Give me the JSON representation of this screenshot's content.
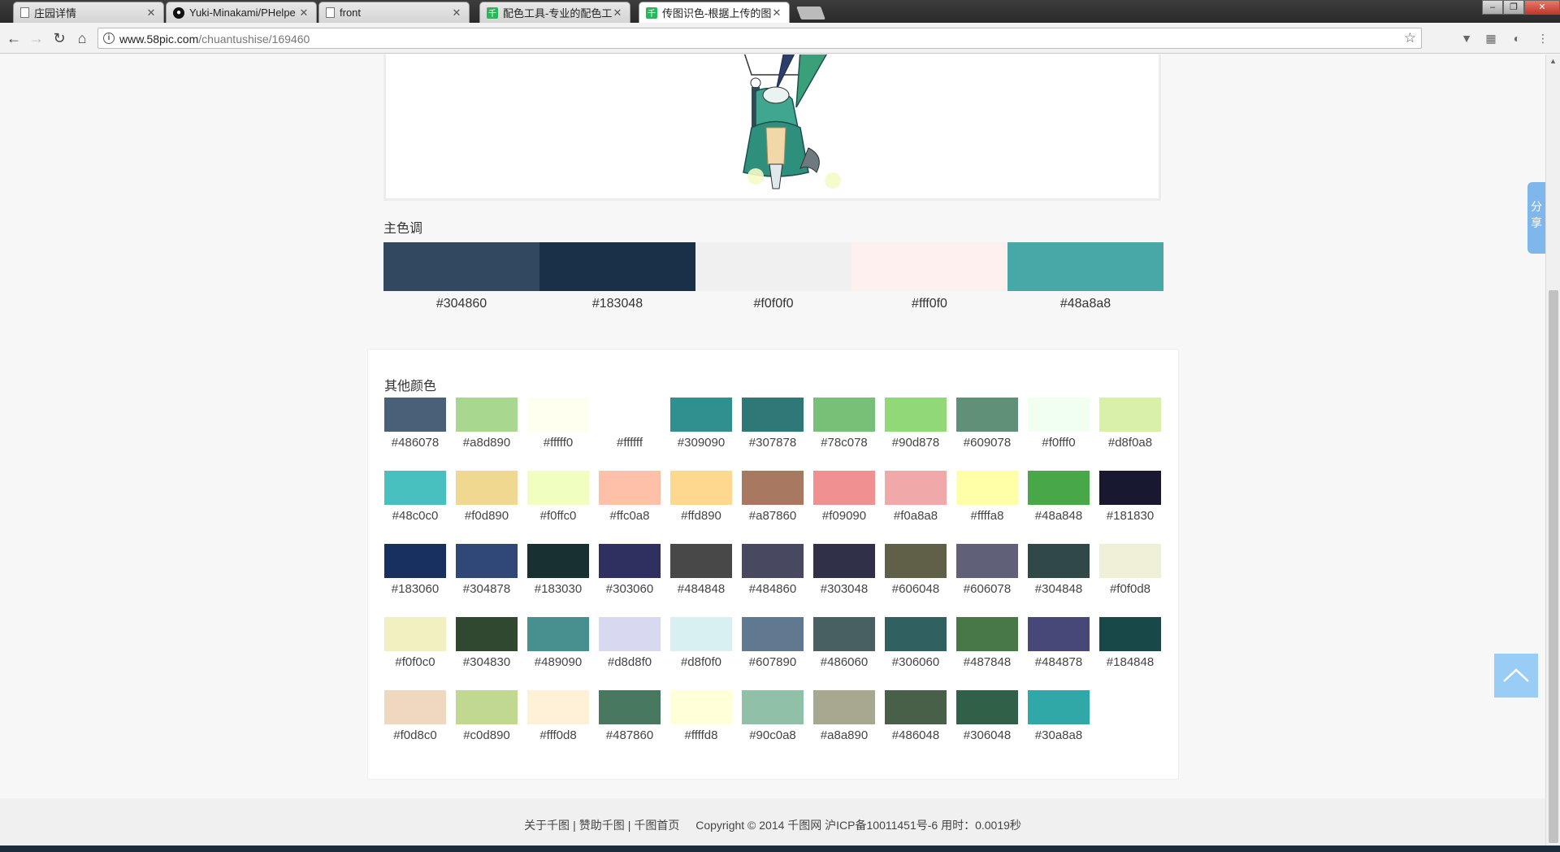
{
  "browser": {
    "tabs": [
      {
        "title": "庄园详情",
        "icon": "doc-icon",
        "active": false
      },
      {
        "title": "Yuki-Minakami/PHelpe",
        "icon": "github-icon",
        "active": false
      },
      {
        "title": "front",
        "icon": "doc-icon",
        "active": false
      },
      {
        "title": "配色工具-专业的配色工具",
        "icon": "qian-icon",
        "active": false
      },
      {
        "title": "传图识色-根据上传的图片",
        "icon": "qian-icon",
        "active": true
      }
    ],
    "window_controls": {
      "minimize": "‒",
      "restore": "❐",
      "close": "✕"
    },
    "url_host": "www.58pic.com",
    "url_path": "/chuantushise/169460"
  },
  "main_colors": {
    "title": "主色调",
    "items": [
      {
        "hex": "#304860",
        "label": "#304860"
      },
      {
        "hex": "#183048",
        "label": "#183048"
      },
      {
        "hex": "#f0f0f0",
        "label": "#f0f0f0"
      },
      {
        "hex": "#fff0f0",
        "label": "#fff0f0"
      },
      {
        "hex": "#48a8a8",
        "label": "#48a8a8"
      }
    ]
  },
  "other_colors": {
    "title": "其他颜色",
    "items": [
      "#486078",
      "#a8d890",
      "#fffff0",
      "#ffffff",
      "#309090",
      "#307878",
      "#78c078",
      "#90d878",
      "#609078",
      "#f0fff0",
      "#d8f0a8",
      "#48c0c0",
      "#f0d890",
      "#f0ffc0",
      "#ffc0a8",
      "#ffd890",
      "#a87860",
      "#f09090",
      "#f0a8a8",
      "#ffffa8",
      "#48a848",
      "#181830",
      "#183060",
      "#304878",
      "#183030",
      "#303060",
      "#484848",
      "#484860",
      "#303048",
      "#606048",
      "#606078",
      "#304848",
      "#f0f0d8",
      "#f0f0c0",
      "#304830",
      "#489090",
      "#d8d8f0",
      "#d8f0f0",
      "#607890",
      "#486060",
      "#306060",
      "#487848",
      "#484878",
      "#184848",
      "#f0d8c0",
      "#c0d890",
      "#fff0d8",
      "#487860",
      "#ffffd8",
      "#90c0a8",
      "#a8a890",
      "#486048",
      "#306048",
      "#30a8a8"
    ]
  },
  "footer": {
    "links": [
      "关于千图",
      "赞助千图",
      "千图首页"
    ],
    "copyright": "Copyright © 2014 千图网 沪ICP备10011451号-6 用时：0.0019秒"
  },
  "share_label": "分享",
  "colors": {
    "share": "#7fb7ec",
    "totop": "#9acdf5"
  }
}
